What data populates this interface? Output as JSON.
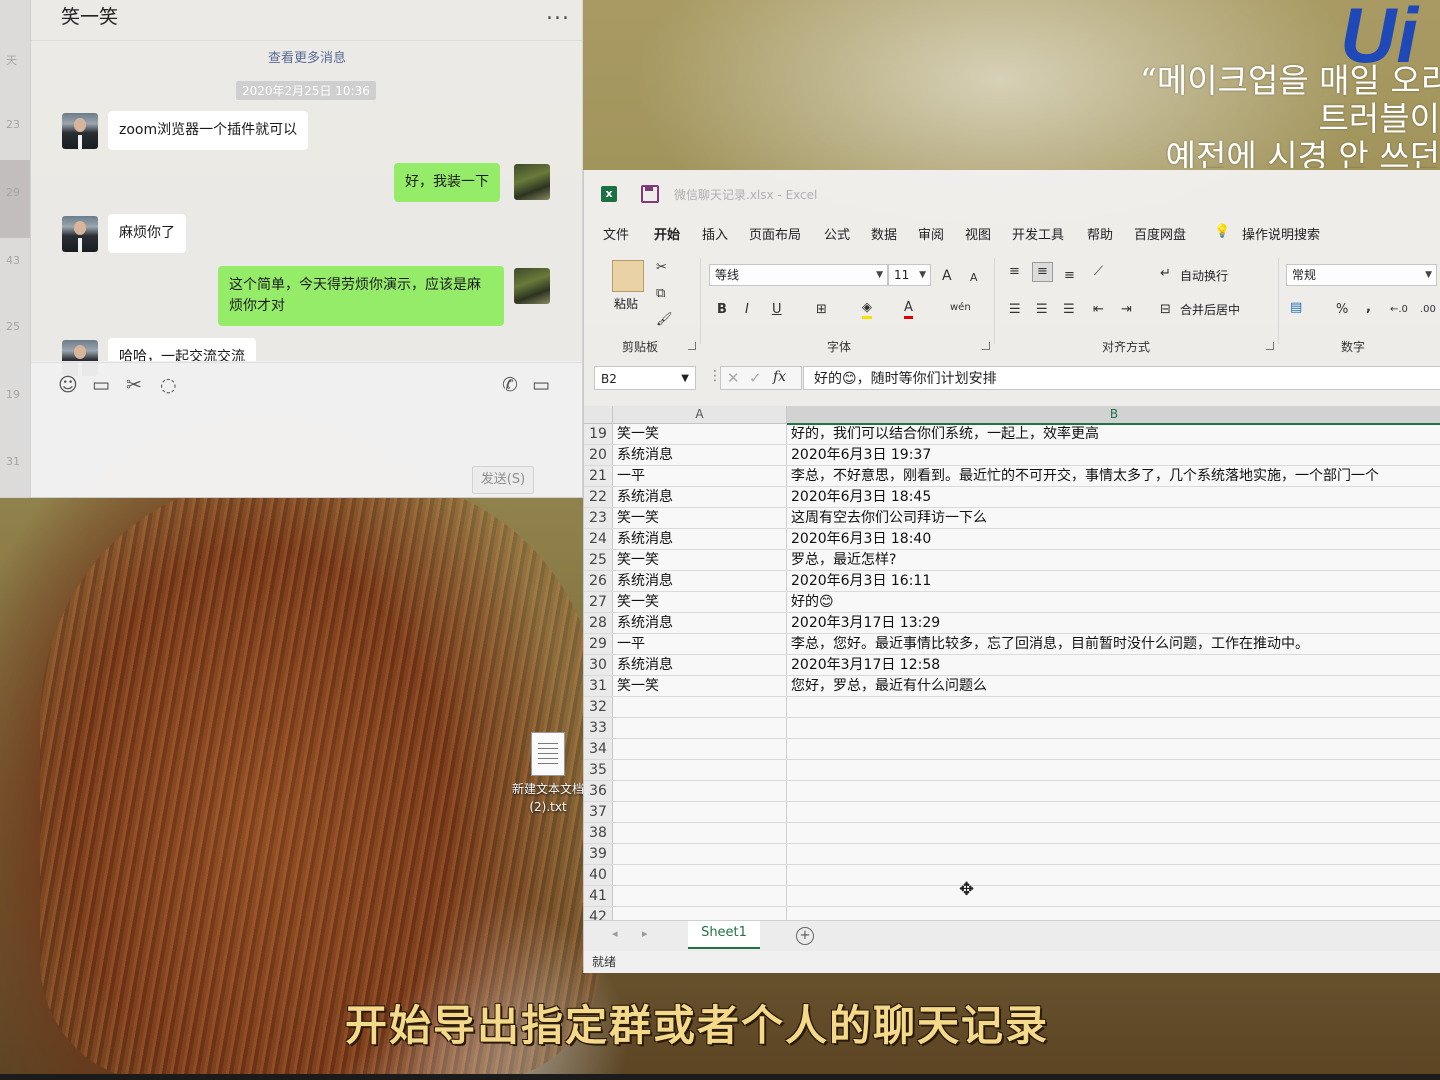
{
  "desktop": {
    "brand_logo": "Ui",
    "korean_lines": [
      "“메이크업을 매일 오리",
      "트러블이",
      "예전에 시경 안 쓰던"
    ],
    "subtitle": "开始导出指定群或者个人的聊天记录",
    "file_icon": {
      "name_line1": "新建文本文档",
      "name_line2": "(2).txt"
    }
  },
  "wechat": {
    "sidebar_times": [
      "天",
      "23",
      "29",
      "43",
      "25",
      "19",
      "31"
    ],
    "title": "笑一笑",
    "more": "...",
    "load_more": "查看更多消息",
    "date": "2020年2月25日 10:36",
    "messages": [
      {
        "side": "in",
        "text": "zoom浏览器一个插件就可以"
      },
      {
        "side": "out",
        "text": "好，我装一下"
      },
      {
        "side": "in",
        "text": "麻烦你了"
      },
      {
        "side": "out",
        "text": "这个简单，今天得劳烦你演示，应该是麻烦你才对"
      },
      {
        "side": "in",
        "text": "哈哈，一起交流交流"
      }
    ],
    "send_label": "发送(S)",
    "tool_icons": [
      "emoji-icon",
      "folder-icon",
      "scissors-icon",
      "chat-history-icon",
      "phone-icon",
      "video-icon"
    ]
  },
  "excel": {
    "title": "微信聊天记录.xlsx - Excel",
    "menu": [
      "文件",
      "开始",
      "插入",
      "页面布局",
      "公式",
      "数据",
      "审阅",
      "视图",
      "开发工具",
      "帮助",
      "百度网盘",
      "操作说明搜索"
    ],
    "active_menu": "开始",
    "ribbon": {
      "clipboard_label": "剪贴板",
      "paste_label": "粘贴",
      "font_label": "字体",
      "font_name": "等线",
      "font_size": "11",
      "align_label": "对齐方式",
      "wrap_label": "自动换行",
      "merge_label": "合并后居中",
      "number_label": "数字",
      "number_format": "常规",
      "bold": "B",
      "italic": "I",
      "underline": "U",
      "grow_font": "A",
      "shrink_font": "A",
      "font_color": "A",
      "percent": "%",
      "comma": ","
    },
    "name_box": "B2",
    "fx_symbol": "fx",
    "formula": "好的😊，随时等你们计划安排",
    "columns": [
      "A",
      "B"
    ],
    "rows": [
      {
        "n": "19",
        "a": "笑一笑",
        "b": "好的，我们可以结合你们系统，一起上，效率更高"
      },
      {
        "n": "20",
        "a": "系统消息",
        "b": "2020年6月3日 19:37"
      },
      {
        "n": "21",
        "a": "一平",
        "b": "李总，不好意思，刚看到。最近忙的不可开交，事情太多了，几个系统落地实施，一个部门一个"
      },
      {
        "n": "22",
        "a": "系统消息",
        "b": "2020年6月3日 18:45"
      },
      {
        "n": "23",
        "a": "笑一笑",
        "b": "这周有空去你们公司拜访一下么"
      },
      {
        "n": "24",
        "a": "系统消息",
        "b": "2020年6月3日 18:40"
      },
      {
        "n": "25",
        "a": "笑一笑",
        "b": "罗总，最近怎样?"
      },
      {
        "n": "26",
        "a": "系统消息",
        "b": "2020年6月3日 16:11"
      },
      {
        "n": "27",
        "a": "笑一笑",
        "b": "好的😊"
      },
      {
        "n": "28",
        "a": "系统消息",
        "b": "2020年3月17日 13:29"
      },
      {
        "n": "29",
        "a": "一平",
        "b": "李总，您好。最近事情比较多，忘了回消息，目前暂时没什么问题，工作在推动中。"
      },
      {
        "n": "30",
        "a": "系统消息",
        "b": "2020年3月17日 12:58"
      },
      {
        "n": "31",
        "a": "笑一笑",
        "b": "您好，罗总，最近有什么问题么"
      },
      {
        "n": "32",
        "a": "",
        "b": ""
      },
      {
        "n": "33",
        "a": "",
        "b": ""
      },
      {
        "n": "34",
        "a": "",
        "b": ""
      },
      {
        "n": "35",
        "a": "",
        "b": ""
      },
      {
        "n": "36",
        "a": "",
        "b": ""
      },
      {
        "n": "37",
        "a": "",
        "b": ""
      },
      {
        "n": "38",
        "a": "",
        "b": ""
      },
      {
        "n": "39",
        "a": "",
        "b": ""
      },
      {
        "n": "40",
        "a": "",
        "b": ""
      },
      {
        "n": "41",
        "a": "",
        "b": ""
      },
      {
        "n": "42",
        "a": "",
        "b": ""
      },
      {
        "n": "43",
        "a": "",
        "b": ""
      }
    ],
    "sheet_tab": "Sheet1",
    "add_sheet": "+",
    "status": "就绪",
    "colors": {
      "accent": "#217346",
      "wechat_green": "#95ec69",
      "subtitle": "#f4d98a"
    }
  }
}
